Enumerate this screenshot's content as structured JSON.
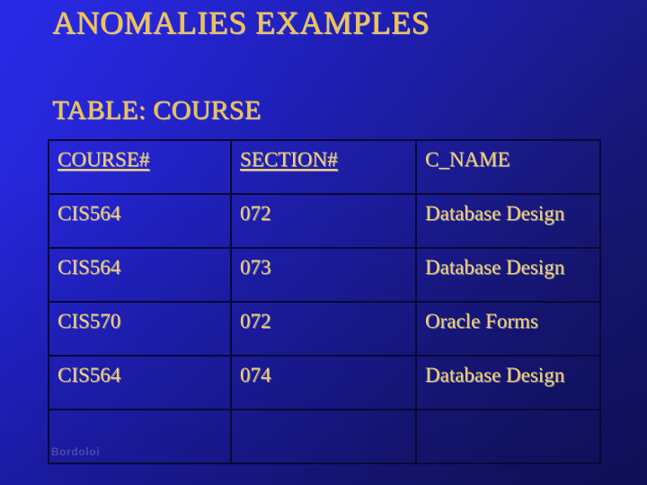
{
  "slide": {
    "title": "ANOMALIES EXAMPLES",
    "table_caption": "TABLE: COURSE",
    "footer": "Bordoloi"
  },
  "colors": {
    "background_light": "#2a2ae8",
    "background_dark": "#121263",
    "title_text": "#f6c243",
    "cell_text": "#f3cf74",
    "border": "#090933",
    "footer_text": "#4b4ba8"
  },
  "table": {
    "name": "COURSE",
    "columns": [
      {
        "label": "COURSE#",
        "primary_key": true
      },
      {
        "label": "SECTION#",
        "primary_key": true
      },
      {
        "label": "C_NAME",
        "primary_key": false
      }
    ],
    "rows": [
      {
        "course": "CIS564",
        "section": "072",
        "c_name": "Database Design"
      },
      {
        "course": "CIS564",
        "section": "073",
        "c_name": "Database Design"
      },
      {
        "course": "CIS570",
        "section": "072",
        "c_name": "Oracle Forms"
      },
      {
        "course": "CIS564",
        "section": "074",
        "c_name": "Database Design"
      },
      {
        "course": "",
        "section": "",
        "c_name": ""
      }
    ]
  }
}
